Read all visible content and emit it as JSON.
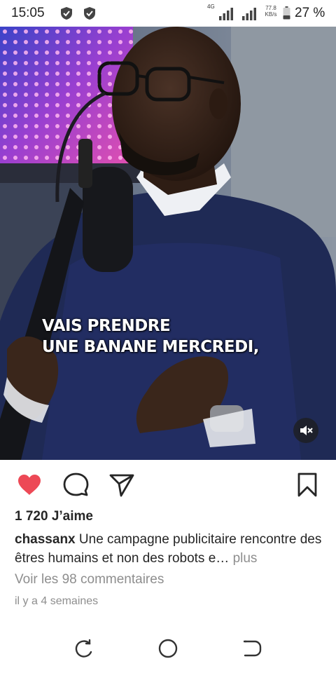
{
  "status_bar": {
    "time": "15:05",
    "network": "4G",
    "speed_value": "77.8",
    "speed_unit": "KB/s",
    "battery": "27 %"
  },
  "video": {
    "caption_line1": "VAIS PRENDRE",
    "caption_line2": "UNE BANANE MERCREDI,",
    "mute_icon": "speaker-muted-icon"
  },
  "actions": {
    "like_icon": "heart-icon",
    "like_color": "#ed4956",
    "comment_icon": "comment-bubble-icon",
    "share_icon": "paper-plane-icon",
    "save_icon": "bookmark-icon"
  },
  "post": {
    "likes": "1 720 J’aime",
    "username": "chassanx",
    "caption": " Une campagne publicitaire rencontre des êtres humains et non des robots e…",
    "more": " plus",
    "view_comments": "Voir les 98 commentaires",
    "time_ago": "il y a 4 semaines"
  },
  "nav": {
    "recent_icon": "recent-apps-icon",
    "home_icon": "home-circle-icon",
    "back_icon": "back-icon"
  }
}
